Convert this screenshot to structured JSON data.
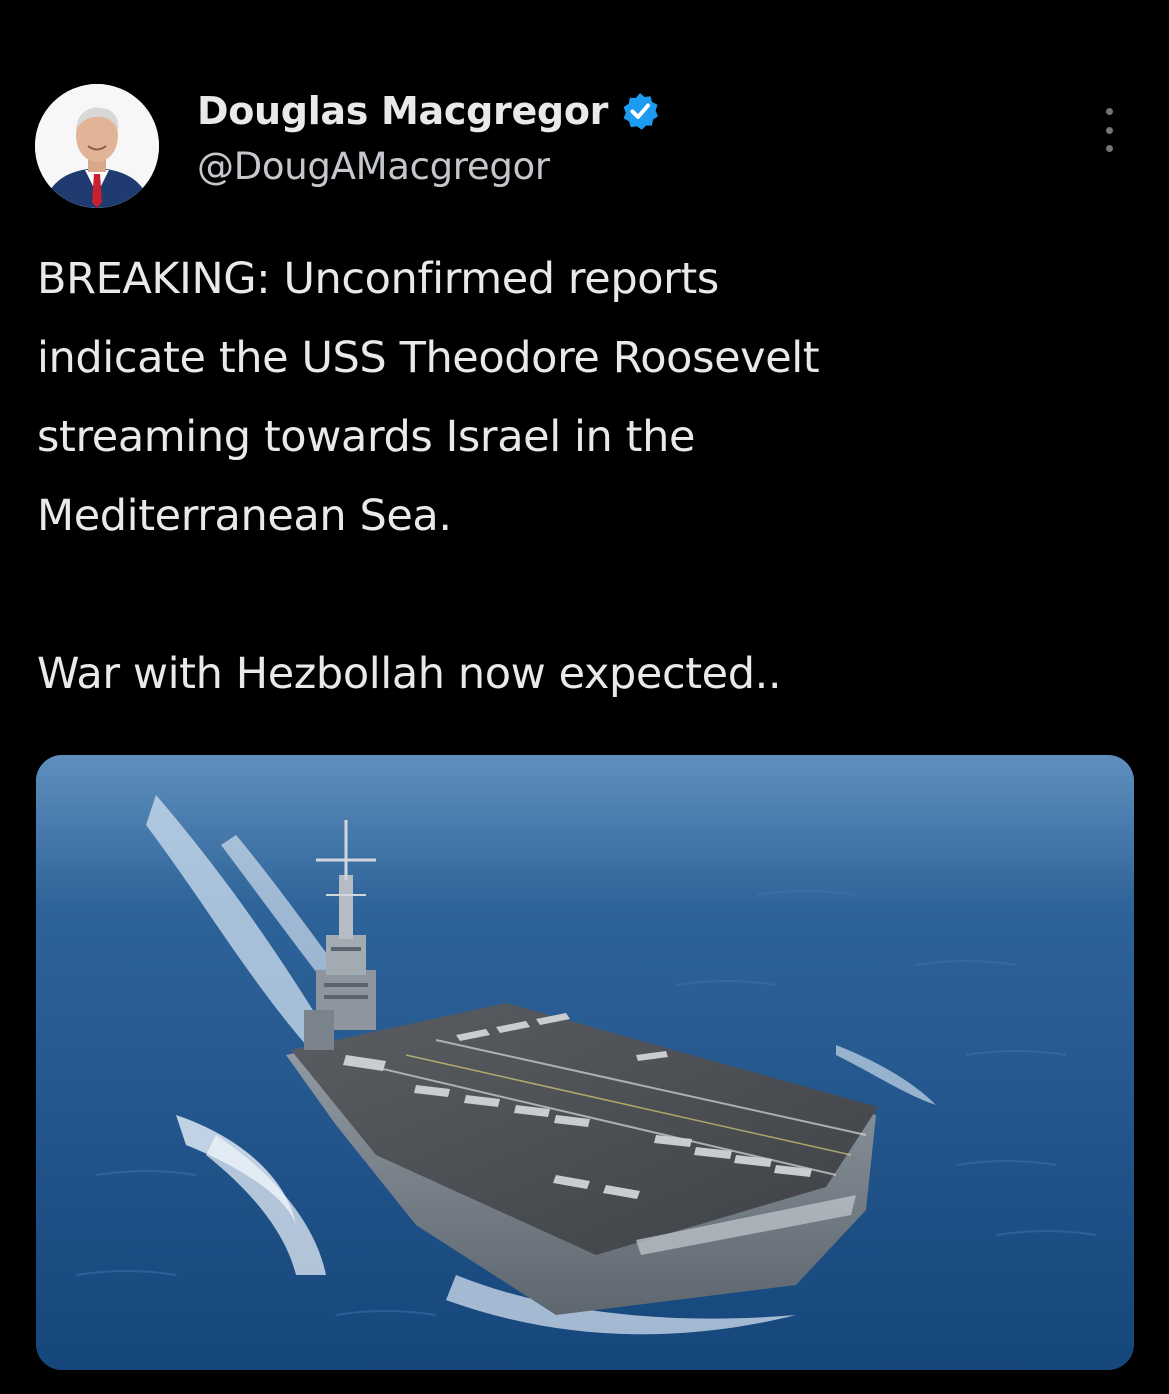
{
  "tweet": {
    "author": {
      "display_name": "Douglas Macgregor",
      "handle": "@DougAMacgregor",
      "verified": true,
      "avatar_icon": "profile-photo"
    },
    "more_icon": "more-options-icon",
    "text": {
      "paragraph_1_line_1": "BREAKING: Unconfirmed reports",
      "paragraph_1_line_2": "indicate the USS Theodore Roosevelt",
      "paragraph_1_line_3": "streaming towards Israel in the",
      "paragraph_1_line_4": "Mediterranean Sea.",
      "paragraph_2": "War with Hezbollah now expected.."
    },
    "media": {
      "type": "photo",
      "subject": "aircraft carrier at sea"
    }
  },
  "colors": {
    "background": "#000000",
    "text_primary": "#e7e9ea",
    "text_secondary": "#c4c8cc",
    "verified_blue": "#1d9bf0",
    "ocean_blue": "#1d4d7c"
  }
}
